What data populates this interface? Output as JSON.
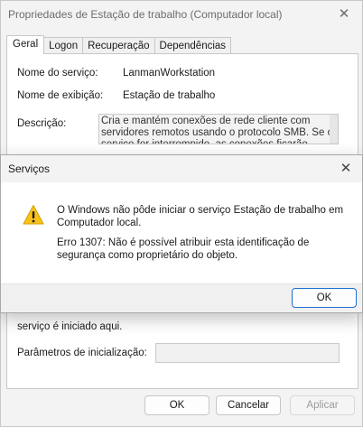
{
  "props_window": {
    "title": "Propriedades de Estação de trabalho (Computador local)",
    "tabs": [
      "Geral",
      "Logon",
      "Recuperação",
      "Dependências"
    ],
    "active_tab": "Geral",
    "service_name_label": "Nome do serviço:",
    "service_name_value": "LanmanWorkstation",
    "display_name_label": "Nome de exibição:",
    "display_name_value": "Estação de trabalho",
    "description_label": "Descrição:",
    "description_value": "Cria e mantém conexões de rede cliente com servidores remotos usando o protocolo SMB. Se o serviço for interrompido, as conexões ficarão",
    "start_hint_text": "serviço é iniciado aqui.",
    "start_params_label": "Parâmetros de inicialização:",
    "start_params_value": "",
    "buttons": {
      "ok": "OK",
      "cancel": "Cancelar",
      "apply": "Aplicar"
    }
  },
  "dialog": {
    "title": "Serviços",
    "icon": "warning-icon",
    "message_line1": "O Windows não pôde iniciar o serviço Estação de trabalho em Computador local.",
    "message_line2": "Erro 1307: Não é possível atribuir esta identificação de segurança como proprietário do objeto.",
    "ok_label": "OK"
  },
  "colors": {
    "accent": "#1f6fd0",
    "warning_fill": "#f8c21b"
  }
}
